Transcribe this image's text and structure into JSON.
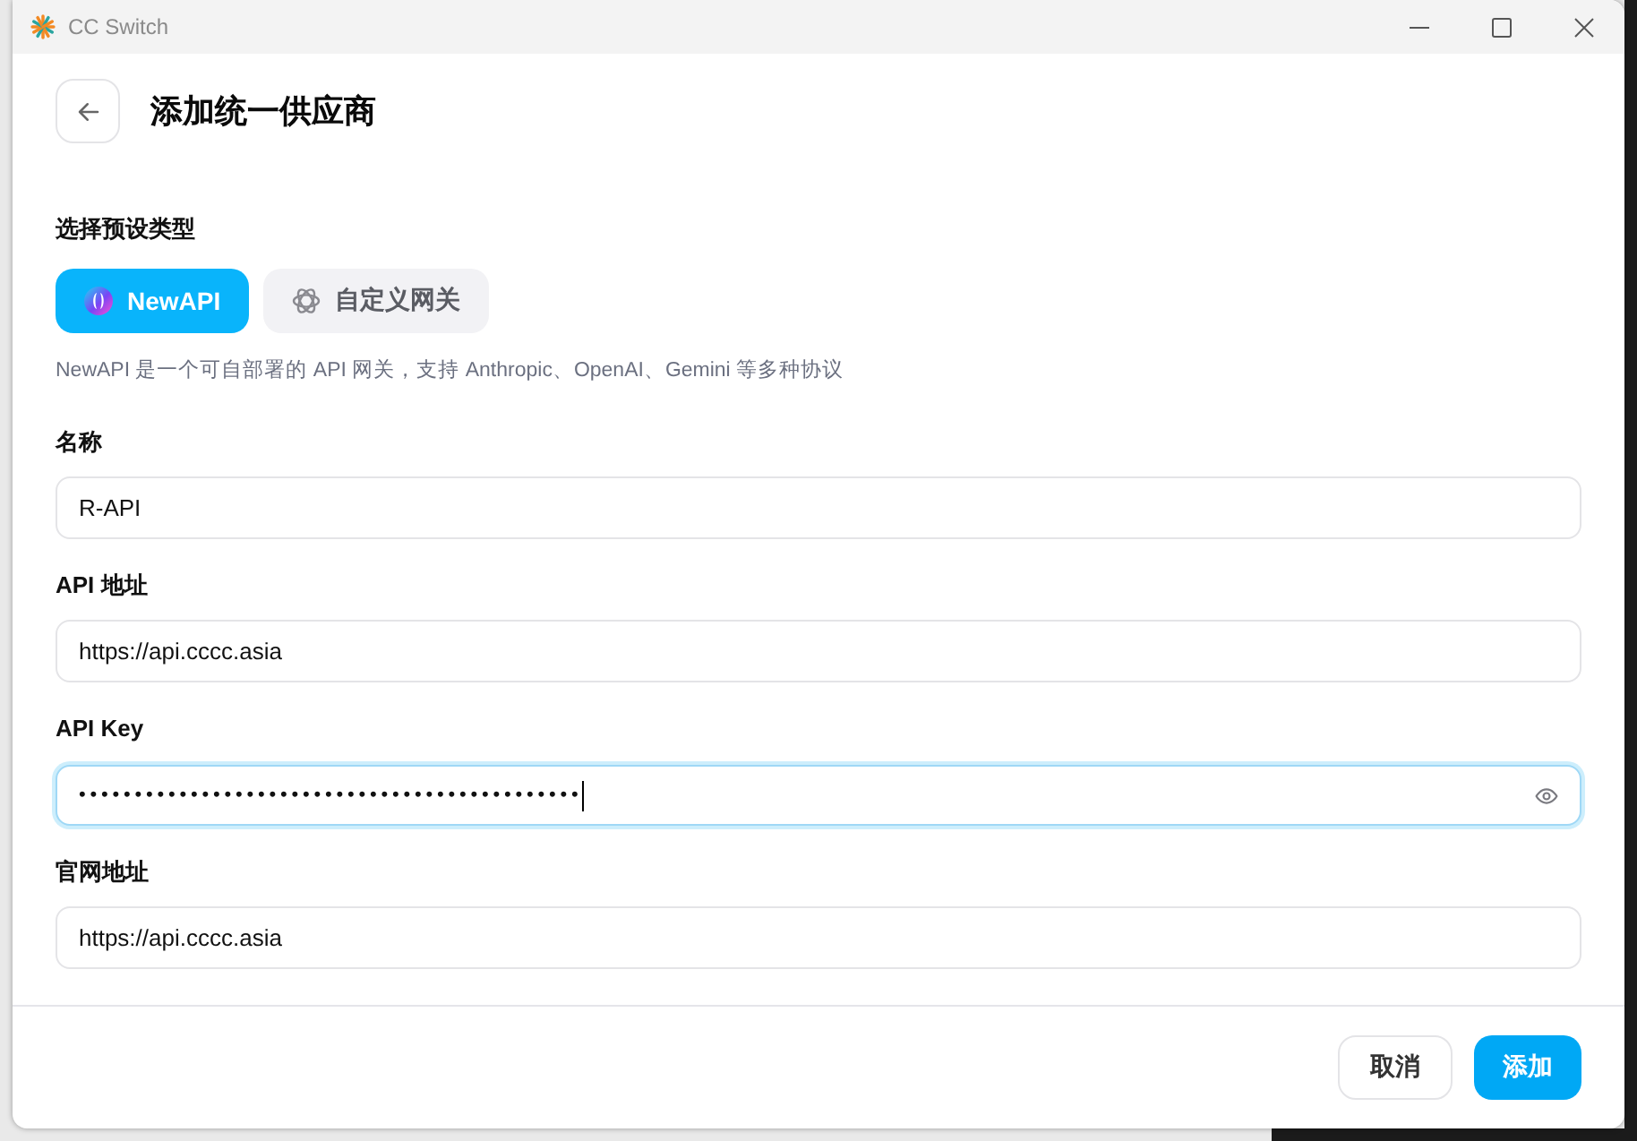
{
  "window": {
    "title": "CC Switch"
  },
  "header": {
    "title": "添加统一供应商"
  },
  "preset_section": {
    "label": "选择预设类型",
    "presets": [
      {
        "kind": "newapi",
        "label": "NewAPI",
        "selected": true
      },
      {
        "kind": "gateway",
        "label": "自定义网关",
        "selected": false
      }
    ],
    "description": "NewAPI 是一个可自部署的 API 网关，支持 Anthropic、OpenAI、Gemini 等多种协议"
  },
  "fields": [
    {
      "kind": "text",
      "label": "名称",
      "value": "R-API",
      "focused": false
    },
    {
      "kind": "text",
      "label": "API 地址",
      "value": "https://api.cccc.asia",
      "focused": false
    },
    {
      "kind": "secret",
      "label": "API Key",
      "value": "•••••••••••••••••••••••••••••••••••••••••••••",
      "focused": true
    },
    {
      "kind": "text",
      "label": "官网地址",
      "value": "https://api.cccc.asia",
      "focused": false
    }
  ],
  "footer": {
    "buttons": [
      {
        "kind": "cancel",
        "label": "取消"
      },
      {
        "kind": "submit",
        "label": "添加"
      }
    ]
  }
}
